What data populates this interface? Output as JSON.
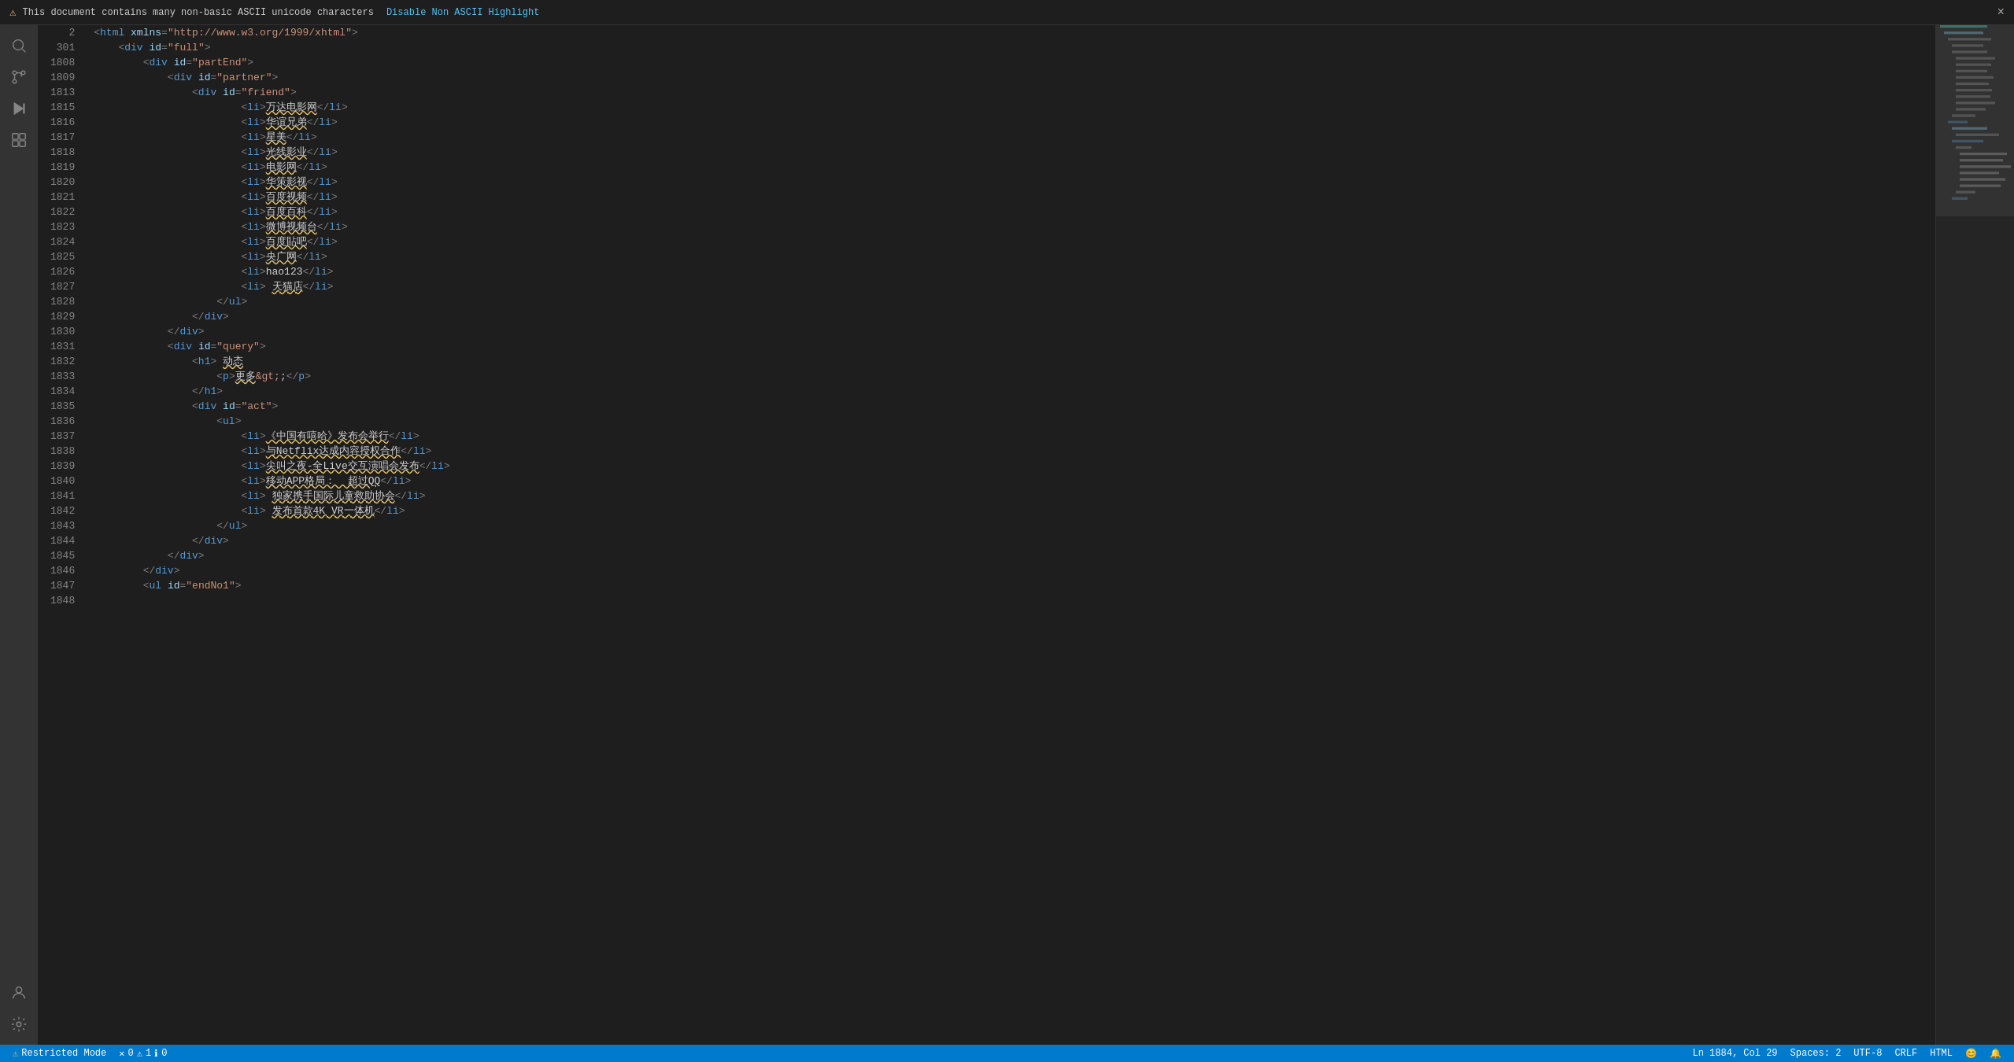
{
  "notification": {
    "warning_icon": "⚠",
    "message": "This document contains many non-basic ASCII unicode characters",
    "action_label": "Disable Non ASCII Highlight",
    "close_icon": "×"
  },
  "activity_bar": {
    "icons": [
      {
        "name": "search",
        "symbol": "🔍",
        "active": false
      },
      {
        "name": "source-control",
        "symbol": "⑂",
        "active": false
      },
      {
        "name": "run",
        "symbol": "▶",
        "active": false
      },
      {
        "name": "extensions",
        "symbol": "⊞",
        "active": false
      }
    ],
    "bottom_icons": [
      {
        "name": "account",
        "symbol": "👤"
      },
      {
        "name": "settings",
        "symbol": "⚙"
      }
    ]
  },
  "code_lines": [
    {
      "number": "2",
      "content": "<html xmlns=\"http://www.w3.org/1999/xhtml\">"
    },
    {
      "number": "301",
      "content": "    <div id=\"full\">"
    },
    {
      "number": "1808",
      "content": "        <div id=\"partEnd\">"
    },
    {
      "number": "1809",
      "content": "            <div id=\"partner\">"
    },
    {
      "number": "1813",
      "content": "                <div id=\"friend\">"
    },
    {
      "number": "1815",
      "content": "                        <li>万达电影网</li>"
    },
    {
      "number": "1816",
      "content": "                        <li>华谊兄弟</li>"
    },
    {
      "number": "1817",
      "content": "                        <li>星美</li>"
    },
    {
      "number": "1818",
      "content": "                        <li>光线影业</li>"
    },
    {
      "number": "1819",
      "content": "                        <li>电影网</li>"
    },
    {
      "number": "1820",
      "content": "                        <li>华策影视</li>"
    },
    {
      "number": "1821",
      "content": "                        <li>百度视频</li>"
    },
    {
      "number": "1822",
      "content": "                        <li>百度百科</li>"
    },
    {
      "number": "1823",
      "content": "                        <li>微博视频台</li>"
    },
    {
      "number": "1824",
      "content": "                        <li>百度貼吧</li>"
    },
    {
      "number": "1825",
      "content": "                        <li>央广网</li>"
    },
    {
      "number": "1826",
      "content": "                        <li>hao123</li>"
    },
    {
      "number": "1827",
      "content": "                        <li> 天猫店</li>"
    },
    {
      "number": "1828",
      "content": "                    </ul>"
    },
    {
      "number": "1829",
      "content": "                </div>"
    },
    {
      "number": "1830",
      "content": "            </div>"
    },
    {
      "number": "1831",
      "content": "            <div id=\"query\">"
    },
    {
      "number": "1832",
      "content": "                <h1> 动态"
    },
    {
      "number": "1833",
      "content": "                    <p>更多&gt;;</p>"
    },
    {
      "number": "1834",
      "content": "                </h1>"
    },
    {
      "number": "1835",
      "content": "                <div id=\"act\">"
    },
    {
      "number": "1836",
      "content": "                    <ul>"
    },
    {
      "number": "1837",
      "content": "                        <li>《中国有嘻哈》发布会举行</li>"
    },
    {
      "number": "1838",
      "content": "                        <li>与Netflix达成内容授权合作</li>"
    },
    {
      "number": "1839",
      "content": "                        <li>尖叫之夜-全Live交互演唱会发布</li>"
    },
    {
      "number": "1840",
      "content": "                        <li>移动APP格局：  超过QQ</li>"
    },
    {
      "number": "1841",
      "content": "                        <li> 独家携手国际儿童救助协会</li>"
    },
    {
      "number": "1842",
      "content": "                        <li> 发布首款4K VR一体机</li>"
    },
    {
      "number": "1843",
      "content": "                    </ul>"
    },
    {
      "number": "1844",
      "content": "                </div>"
    },
    {
      "number": "1845",
      "content": "            </div>"
    },
    {
      "number": "1846",
      "content": "        </div>"
    },
    {
      "number": "1847",
      "content": "        <ul id=\"endNo1\">"
    },
    {
      "number": "1848",
      "content": ""
    }
  ],
  "status_bar": {
    "restricted_mode": "Restricted Mode",
    "warning_icon": "⚠",
    "errors_icon": "✕",
    "errors_count": "0",
    "warnings_icon": "⚠",
    "warnings_count": "1",
    "info_icon": "ℹ",
    "info_count": "0",
    "position": "Ln 1884, Col 29",
    "spaces": "Spaces: 2",
    "encoding": "UTF-8",
    "line_ending": "CRLF",
    "language": "HTML",
    "feedback_icon": "😊",
    "notification_icon": "🔔"
  }
}
